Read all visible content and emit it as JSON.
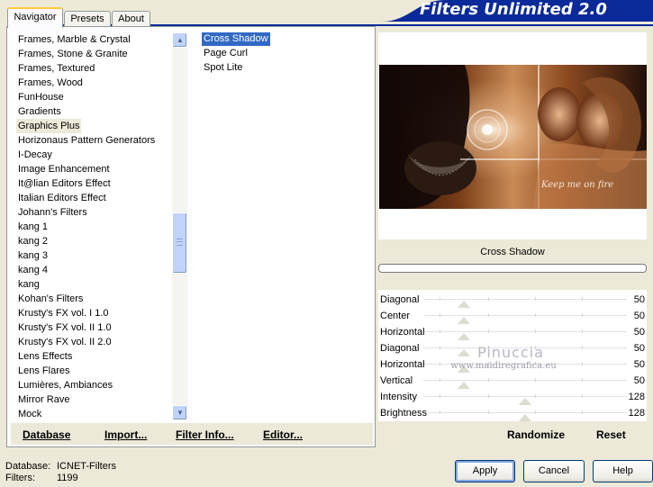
{
  "app": {
    "title": "Filters Unlimited 2.0"
  },
  "tabs": [
    {
      "label": "Navigator",
      "active": true
    },
    {
      "label": "Presets",
      "active": false
    },
    {
      "label": "About",
      "active": false
    }
  ],
  "categories": {
    "items": [
      "Frames, Marble & Crystal",
      "Frames, Stone & Granite",
      "Frames, Textured",
      "Frames, Wood",
      "FunHouse",
      "Gradients",
      "Graphics Plus",
      "Horizonaus Pattern Generators",
      "I-Decay",
      "Image Enhancement",
      "It@lian Editors Effect",
      "Italian Editors Effect",
      "Johann's Filters",
      "kang 1",
      "kang 2",
      "kang 3",
      "kang 4",
      "kang",
      "Kohan's Filters",
      "Krusty's FX vol. I 1.0",
      "Krusty's FX vol. II 1.0",
      "Krusty's FX vol. II 2.0",
      "Lens Effects",
      "Lens Flares",
      "Lumières, Ambiances",
      "Mirror Rave",
      "Mock"
    ],
    "selected": "Graphics Plus",
    "scroll_position": 0.46
  },
  "filters": {
    "items": [
      "Cross Shadow",
      "Page Curl",
      "Spot Lite"
    ],
    "selected": "Cross Shadow"
  },
  "left_buttons": {
    "database": "Database",
    "import": "Import...",
    "filter_info": "Filter Info...",
    "editor": "Editor..."
  },
  "preview": {
    "watermark_text": "Keep me on fire"
  },
  "current_filter": "Cross Shadow",
  "progress": 0,
  "parameters": [
    {
      "label": "Diagonal",
      "value": "50",
      "level": 0.2
    },
    {
      "label": "Center",
      "value": "50",
      "level": 0.2
    },
    {
      "label": "Horizontal",
      "value": "50",
      "level": 0.2
    },
    {
      "label": "Diagonal",
      "value": "50",
      "level": 0.2
    },
    {
      "label": "Horizontal",
      "value": "50",
      "level": 0.2
    },
    {
      "label": "Vertical",
      "value": "50",
      "level": 0.2
    },
    {
      "label": "Intensity",
      "value": "128",
      "level": 0.5
    },
    {
      "label": "Brightness",
      "value": "128",
      "level": 0.5
    }
  ],
  "watermark": {
    "name": "Pinuccia",
    "url": "www.maidiregrafica.eu"
  },
  "right_buttons": {
    "randomize": "Randomize",
    "reset": "Reset"
  },
  "status": {
    "database_label": "Database:",
    "database_value": "ICNET-Filters",
    "filters_label": "Filters:",
    "filters_value": "1199"
  },
  "dialog_buttons": {
    "apply": "Apply",
    "cancel": "Cancel",
    "help": "Help"
  },
  "colors": {
    "banner": "#0a2a9a",
    "selection": "#316ac5",
    "tab_highlight": "#ffc83c"
  }
}
